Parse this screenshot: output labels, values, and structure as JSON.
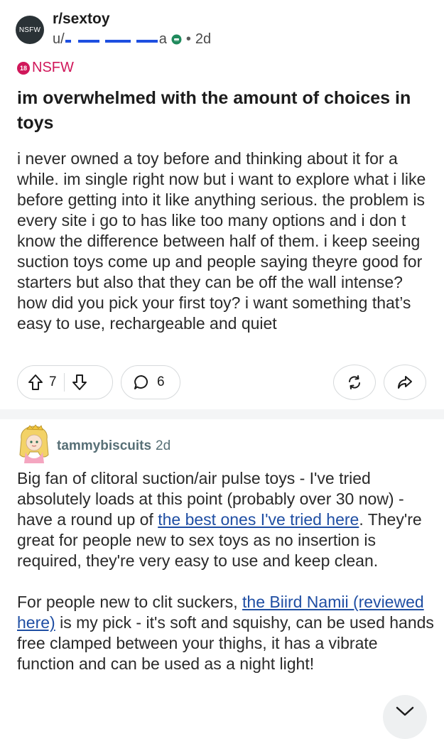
{
  "post": {
    "subreddit": "r/sextoy",
    "subreddit_avatar_text": "NSFW",
    "user_prefix": "u/",
    "user_suffix": "a",
    "age": "2d",
    "dot": "•",
    "nsfw_badge": "18",
    "nsfw_label": "NSFW",
    "title": "im overwhelmed with the amount of choices in toys",
    "body": "i never owned a toy before and thinking about it for a while. im single right now but i want to explore what i like before getting into it like anything serious. the problem is every site i go to has like too many options and i don t know the difference between half of them. i keep seeing suction toys come up and people saying theyre good for starters but also that they can be off the wall intense? how did you pick your first toy? i want something that’s easy to use, rechargeable and quiet",
    "upvotes": "7",
    "comments": "6"
  },
  "comment": {
    "author": "tammybiscuits",
    "age": "2d",
    "p1_before": "Big fan of clitoral suction/air pulse toys - I've tried absolutely loads at this point (probably over 30 now) - have a round up of ",
    "p1_link": "the best ones I've tried here",
    "p1_after": ". They're great for people new to sex toys as no insertion is required, they're very easy to use and keep clean.",
    "p2_before": "For people new to clit suckers, ",
    "p2_link": "the Biird Namii (reviewed here)",
    "p2_after": " is my pick - it's soft and squishy, can be used hands free clamped between your thighs, it has a vibrate function and can be used as a night light!"
  },
  "icons": {
    "upvote": "arrow-up-outline-icon",
    "downvote": "arrow-down-outline-icon",
    "comment": "speech-bubble-icon",
    "award": "award-swap-icon",
    "share": "share-arrow-icon",
    "mod": "mod-shield-icon",
    "expand": "chevron-down-icon"
  },
  "colors": {
    "nsfw": "#d0175a",
    "link": "#1f4ea3",
    "redaction": "#1e4fe0",
    "mod_badge": "#1f8a5c"
  }
}
